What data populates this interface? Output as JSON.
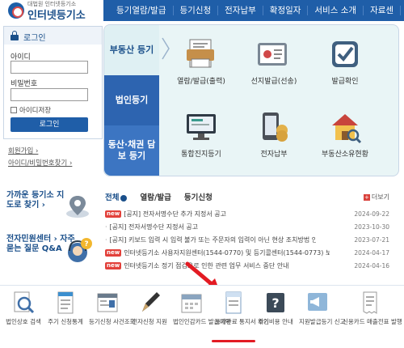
{
  "header": {
    "logo_sub": "대법원 인터넷등기소",
    "logo_text": "인터넷등기소",
    "nav": [
      "등기열람/발급",
      "등기신청",
      "전자납부",
      "확정일자",
      "서비스 소개",
      "자료센"
    ]
  },
  "login": {
    "title": "로그인",
    "id_label": "아이디",
    "pw_label": "비밀번호",
    "save_id": "아이디저장",
    "button": "로그인",
    "signup": "회원가입 ›",
    "find": "아이디/비밀번호찾기 ›"
  },
  "services": {
    "tabs": [
      "부동산 등기",
      "법인등기",
      "동산·채권 담보 등기"
    ],
    "items": [
      {
        "label": "열람/발급(출력)",
        "icon": "document-print-icon"
      },
      {
        "label": "선지발급(선송)",
        "icon": "certificate-tablet-icon"
      },
      {
        "label": "발급확인",
        "icon": "check-mark-icon"
      },
      {
        "label": "통합진지등기",
        "icon": "monitor-icon"
      },
      {
        "label": "전자납부",
        "icon": "phone-coins-icon"
      },
      {
        "label": "부동산소유현황",
        "icon": "house-search-icon"
      }
    ]
  },
  "quick": {
    "map_title": "가까운 등기소 지도로 찾기 ›",
    "center_title": "전자민원센터 › 자주 묻는 질문 Q&A"
  },
  "board": {
    "tabs": [
      "전체",
      "열람/발급",
      "등기신청"
    ],
    "more": "더보기",
    "new_label": "new",
    "notices": [
      {
        "title": "[공지] 전자서명수단 추가 지정서 공고",
        "date": "2024-09-22",
        "is_new": true
      },
      {
        "title": "[공지] 전자서명수단 지정서 공고",
        "date": "2023-10-30",
        "is_new": false
      },
      {
        "title": "[공지] 키보드 입력 시 입력 불가 또는 주문자의 입력이 아닌 현상 조치방법 안내",
        "date": "2023-07-21",
        "is_new": false
      },
      {
        "title": "인터넷등기소 사용자지원센터(1544-0770) 및 등기콜센터(1544-0773) 보...",
        "date": "2024-04-17",
        "is_new": true
      },
      {
        "title": "인터넷등기소 정기 점검으로 인한 관련 업무 서비스 중단 안내",
        "date": "2024-04-16",
        "is_new": true
      }
    ]
  },
  "bottom": [
    {
      "label": "법인상호 검색",
      "icon": "magnifier-doc-icon"
    },
    {
      "label": "주기 신청통계",
      "icon": "document-icon"
    },
    {
      "label": "등기신청 사건조회",
      "icon": "case-lookup-icon"
    },
    {
      "label": "전자신청 지원",
      "icon": "pen-icon"
    },
    {
      "label": "법인인감카드 발급예약",
      "icon": "calendar-icon"
    },
    {
      "label": "등기완료 통지서 확인",
      "icon": "notice-paper-icon"
    },
    {
      "label": "주기비용 안내",
      "icon": "question-icon"
    },
    {
      "label": "지원발급등기 신고",
      "icon": "megaphone-icon"
    },
    {
      "label": "신용카드 매출전표 발행",
      "icon": "receipt-icon"
    }
  ],
  "colors": {
    "brand_blue": "#1f5ea8",
    "new_red": "#e2413b",
    "annotation_red": "#e31b23"
  }
}
